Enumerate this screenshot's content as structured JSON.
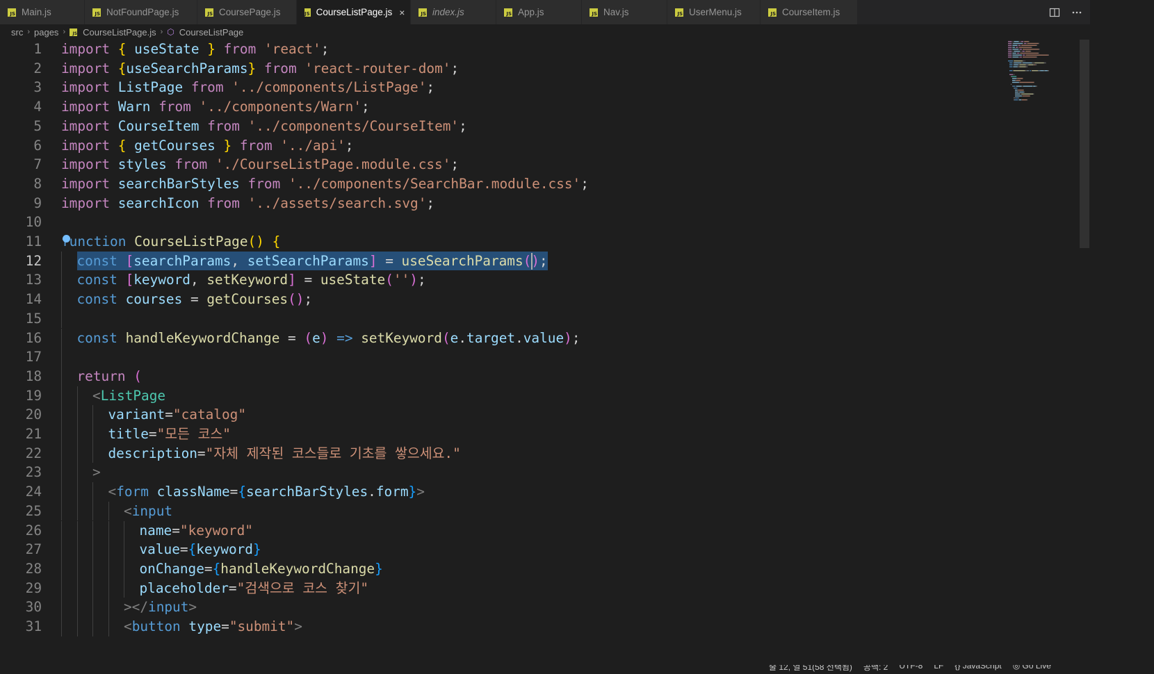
{
  "tabs": [
    {
      "label": "Main.js",
      "italic": false,
      "active": false
    },
    {
      "label": "NotFoundPage.js",
      "italic": false,
      "active": false
    },
    {
      "label": "CoursePage.js",
      "italic": false,
      "active": false
    },
    {
      "label": "CourseListPage.js",
      "italic": false,
      "active": true
    },
    {
      "label": "index.js",
      "italic": true,
      "active": false
    },
    {
      "label": "App.js",
      "italic": false,
      "active": false
    },
    {
      "label": "Nav.js",
      "italic": false,
      "active": false
    },
    {
      "label": "UserMenu.js",
      "italic": false,
      "active": false
    },
    {
      "label": "CourseItem.js",
      "italic": false,
      "active": false
    }
  ],
  "tab_icon_text": "JS",
  "tab_close_glyph": "×",
  "breadcrumb": {
    "parts": [
      "src",
      "pages",
      "CourseListPage.js",
      "CourseListPage"
    ]
  },
  "editor": {
    "current_line": 12,
    "lines": [
      {
        "n": "1",
        "indent": 0,
        "tokens": [
          [
            "k",
            "import"
          ],
          [
            "p",
            " "
          ],
          [
            "b1",
            "{"
          ],
          [
            "p",
            " "
          ],
          [
            "v",
            "useState"
          ],
          [
            "p",
            " "
          ],
          [
            "b1",
            "}"
          ],
          [
            "p",
            " "
          ],
          [
            "k",
            "from"
          ],
          [
            "p",
            " "
          ],
          [
            "s",
            "'react'"
          ],
          [
            "p",
            ";"
          ]
        ]
      },
      {
        "n": "2",
        "indent": 0,
        "tokens": [
          [
            "k",
            "import"
          ],
          [
            "p",
            " "
          ],
          [
            "b1",
            "{"
          ],
          [
            "v",
            "useSearchParams"
          ],
          [
            "b1",
            "}"
          ],
          [
            "p",
            " "
          ],
          [
            "k",
            "from"
          ],
          [
            "p",
            " "
          ],
          [
            "s",
            "'react-router-dom'"
          ],
          [
            "p",
            ";"
          ]
        ]
      },
      {
        "n": "3",
        "indent": 0,
        "tokens": [
          [
            "k",
            "import"
          ],
          [
            "p",
            " "
          ],
          [
            "v",
            "ListPage"
          ],
          [
            "p",
            " "
          ],
          [
            "k",
            "from"
          ],
          [
            "p",
            " "
          ],
          [
            "s",
            "'../components/ListPage'"
          ],
          [
            "p",
            ";"
          ]
        ]
      },
      {
        "n": "4",
        "indent": 0,
        "tokens": [
          [
            "k",
            "import"
          ],
          [
            "p",
            " "
          ],
          [
            "v",
            "Warn"
          ],
          [
            "p",
            " "
          ],
          [
            "k",
            "from"
          ],
          [
            "p",
            " "
          ],
          [
            "s",
            "'../components/Warn'"
          ],
          [
            "p",
            ";"
          ]
        ]
      },
      {
        "n": "5",
        "indent": 0,
        "tokens": [
          [
            "k",
            "import"
          ],
          [
            "p",
            " "
          ],
          [
            "v",
            "CourseItem"
          ],
          [
            "p",
            " "
          ],
          [
            "k",
            "from"
          ],
          [
            "p",
            " "
          ],
          [
            "s",
            "'../components/CourseItem'"
          ],
          [
            "p",
            ";"
          ]
        ]
      },
      {
        "n": "6",
        "indent": 0,
        "tokens": [
          [
            "k",
            "import"
          ],
          [
            "p",
            " "
          ],
          [
            "b1",
            "{"
          ],
          [
            "p",
            " "
          ],
          [
            "v",
            "getCourses"
          ],
          [
            "p",
            " "
          ],
          [
            "b1",
            "}"
          ],
          [
            "p",
            " "
          ],
          [
            "k",
            "from"
          ],
          [
            "p",
            " "
          ],
          [
            "s",
            "'../api'"
          ],
          [
            "p",
            ";"
          ]
        ]
      },
      {
        "n": "7",
        "indent": 0,
        "tokens": [
          [
            "k",
            "import"
          ],
          [
            "p",
            " "
          ],
          [
            "v",
            "styles"
          ],
          [
            "p",
            " "
          ],
          [
            "k",
            "from"
          ],
          [
            "p",
            " "
          ],
          [
            "s",
            "'./CourseListPage.module.css'"
          ],
          [
            "p",
            ";"
          ]
        ]
      },
      {
        "n": "8",
        "indent": 0,
        "tokens": [
          [
            "k",
            "import"
          ],
          [
            "p",
            " "
          ],
          [
            "v",
            "searchBarStyles"
          ],
          [
            "p",
            " "
          ],
          [
            "k",
            "from"
          ],
          [
            "p",
            " "
          ],
          [
            "s",
            "'../components/SearchBar.module.css'"
          ],
          [
            "p",
            ";"
          ]
        ]
      },
      {
        "n": "9",
        "indent": 0,
        "tokens": [
          [
            "k",
            "import"
          ],
          [
            "p",
            " "
          ],
          [
            "v",
            "searchIcon"
          ],
          [
            "p",
            " "
          ],
          [
            "k",
            "from"
          ],
          [
            "p",
            " "
          ],
          [
            "s",
            "'../assets/search.svg'"
          ],
          [
            "p",
            ";"
          ]
        ]
      },
      {
        "n": "10",
        "indent": 0,
        "tokens": []
      },
      {
        "n": "11",
        "indent": 0,
        "tokens": [
          [
            "kb",
            "function"
          ],
          [
            "p",
            " "
          ],
          [
            "f",
            "CourseListPage"
          ],
          [
            "b1",
            "()"
          ],
          [
            "p",
            " "
          ],
          [
            "b1",
            "{"
          ]
        ]
      },
      {
        "n": "12",
        "indent": 1,
        "highlight": true,
        "tokens": [
          [
            "kb",
            "const"
          ],
          [
            "p",
            " "
          ],
          [
            "b2",
            "["
          ],
          [
            "v",
            "searchParams"
          ],
          [
            "p",
            ", "
          ],
          [
            "v",
            "setSearchParams"
          ],
          [
            "b2",
            "]"
          ],
          [
            "p",
            " = "
          ],
          [
            "f",
            "useSearchParams"
          ],
          [
            "b2",
            "()"
          ],
          [
            "p",
            ";"
          ]
        ]
      },
      {
        "n": "13",
        "indent": 1,
        "tokens": [
          [
            "kb",
            "const"
          ],
          [
            "p",
            " "
          ],
          [
            "b2",
            "["
          ],
          [
            "v",
            "keyword"
          ],
          [
            "p",
            ", "
          ],
          [
            "f",
            "setKeyword"
          ],
          [
            "b2",
            "]"
          ],
          [
            "p",
            " = "
          ],
          [
            "f",
            "useState"
          ],
          [
            "b2",
            "("
          ],
          [
            "s",
            "''"
          ],
          [
            "b2",
            ")"
          ],
          [
            "p",
            ";"
          ]
        ]
      },
      {
        "n": "14",
        "indent": 1,
        "tokens": [
          [
            "kb",
            "const"
          ],
          [
            "p",
            " "
          ],
          [
            "v",
            "courses"
          ],
          [
            "p",
            " = "
          ],
          [
            "f",
            "getCourses"
          ],
          [
            "b2",
            "()"
          ],
          [
            "p",
            ";"
          ]
        ]
      },
      {
        "n": "15",
        "indent": 1,
        "tokens": []
      },
      {
        "n": "16",
        "indent": 1,
        "tokens": [
          [
            "kb",
            "const"
          ],
          [
            "p",
            " "
          ],
          [
            "f",
            "handleKeywordChange"
          ],
          [
            "p",
            " = "
          ],
          [
            "b2",
            "("
          ],
          [
            "v",
            "e"
          ],
          [
            "b2",
            ")"
          ],
          [
            "p",
            " "
          ],
          [
            "kb",
            "=>"
          ],
          [
            "p",
            " "
          ],
          [
            "f",
            "setKeyword"
          ],
          [
            "b2",
            "("
          ],
          [
            "v",
            "e"
          ],
          [
            "p",
            "."
          ],
          [
            "v",
            "target"
          ],
          [
            "p",
            "."
          ],
          [
            "v",
            "value"
          ],
          [
            "b2",
            ")"
          ],
          [
            "p",
            ";"
          ]
        ]
      },
      {
        "n": "17",
        "indent": 1,
        "tokens": []
      },
      {
        "n": "18",
        "indent": 1,
        "tokens": [
          [
            "k",
            "return"
          ],
          [
            "p",
            " "
          ],
          [
            "b2",
            "("
          ]
        ]
      },
      {
        "n": "19",
        "indent": 2,
        "tokens": [
          [
            "g",
            "<"
          ],
          [
            "t",
            "ListPage"
          ]
        ]
      },
      {
        "n": "20",
        "indent": 3,
        "tokens": [
          [
            "v",
            "variant"
          ],
          [
            "p",
            "="
          ],
          [
            "s",
            "\"catalog\""
          ]
        ]
      },
      {
        "n": "21",
        "indent": 3,
        "tokens": [
          [
            "v",
            "title"
          ],
          [
            "p",
            "="
          ],
          [
            "s",
            "\"모든 코스\""
          ]
        ]
      },
      {
        "n": "22",
        "indent": 3,
        "tokens": [
          [
            "v",
            "description"
          ],
          [
            "p",
            "="
          ],
          [
            "s",
            "\"자체 제작된 코스들로 기초를 쌓으세요.\""
          ]
        ]
      },
      {
        "n": "23",
        "indent": 2,
        "tokens": [
          [
            "g",
            ">"
          ]
        ]
      },
      {
        "n": "24",
        "indent": 3,
        "tokens": [
          [
            "g",
            "<"
          ],
          [
            "kb",
            "form"
          ],
          [
            "p",
            " "
          ],
          [
            "v",
            "className"
          ],
          [
            "p",
            "="
          ],
          [
            "b3",
            "{"
          ],
          [
            "v",
            "searchBarStyles"
          ],
          [
            "p",
            "."
          ],
          [
            "v",
            "form"
          ],
          [
            "b3",
            "}"
          ],
          [
            "g",
            ">"
          ]
        ]
      },
      {
        "n": "25",
        "indent": 4,
        "tokens": [
          [
            "g",
            "<"
          ],
          [
            "kb",
            "input"
          ]
        ]
      },
      {
        "n": "26",
        "indent": 5,
        "tokens": [
          [
            "v",
            "name"
          ],
          [
            "p",
            "="
          ],
          [
            "s",
            "\"keyword\""
          ]
        ]
      },
      {
        "n": "27",
        "indent": 5,
        "tokens": [
          [
            "v",
            "value"
          ],
          [
            "p",
            "="
          ],
          [
            "b3",
            "{"
          ],
          [
            "v",
            "keyword"
          ],
          [
            "b3",
            "}"
          ]
        ]
      },
      {
        "n": "28",
        "indent": 5,
        "tokens": [
          [
            "v",
            "onChange"
          ],
          [
            "p",
            "="
          ],
          [
            "b3",
            "{"
          ],
          [
            "f",
            "handleKeywordChange"
          ],
          [
            "b3",
            "}"
          ]
        ]
      },
      {
        "n": "29",
        "indent": 5,
        "tokens": [
          [
            "v",
            "placeholder"
          ],
          [
            "p",
            "="
          ],
          [
            "s",
            "\"검색으로 코스 찾기\""
          ]
        ]
      },
      {
        "n": "30",
        "indent": 4,
        "tokens": [
          [
            "g",
            "></"
          ],
          [
            "kb",
            "input"
          ],
          [
            "g",
            ">"
          ]
        ]
      },
      {
        "n": "31",
        "indent": 4,
        "tokens": [
          [
            "g",
            "<"
          ],
          [
            "kb",
            "button"
          ],
          [
            "p",
            " "
          ],
          [
            "v",
            "type"
          ],
          [
            "p",
            "="
          ],
          [
            "s",
            "\"submit\""
          ],
          [
            "g",
            ">"
          ]
        ]
      }
    ]
  },
  "status": {
    "items": [
      "줄 12, 열 51(58 선택됨)",
      "공백: 2",
      "UTF-8",
      "LF",
      "{} JavaScript",
      "◎ Go Live"
    ]
  }
}
